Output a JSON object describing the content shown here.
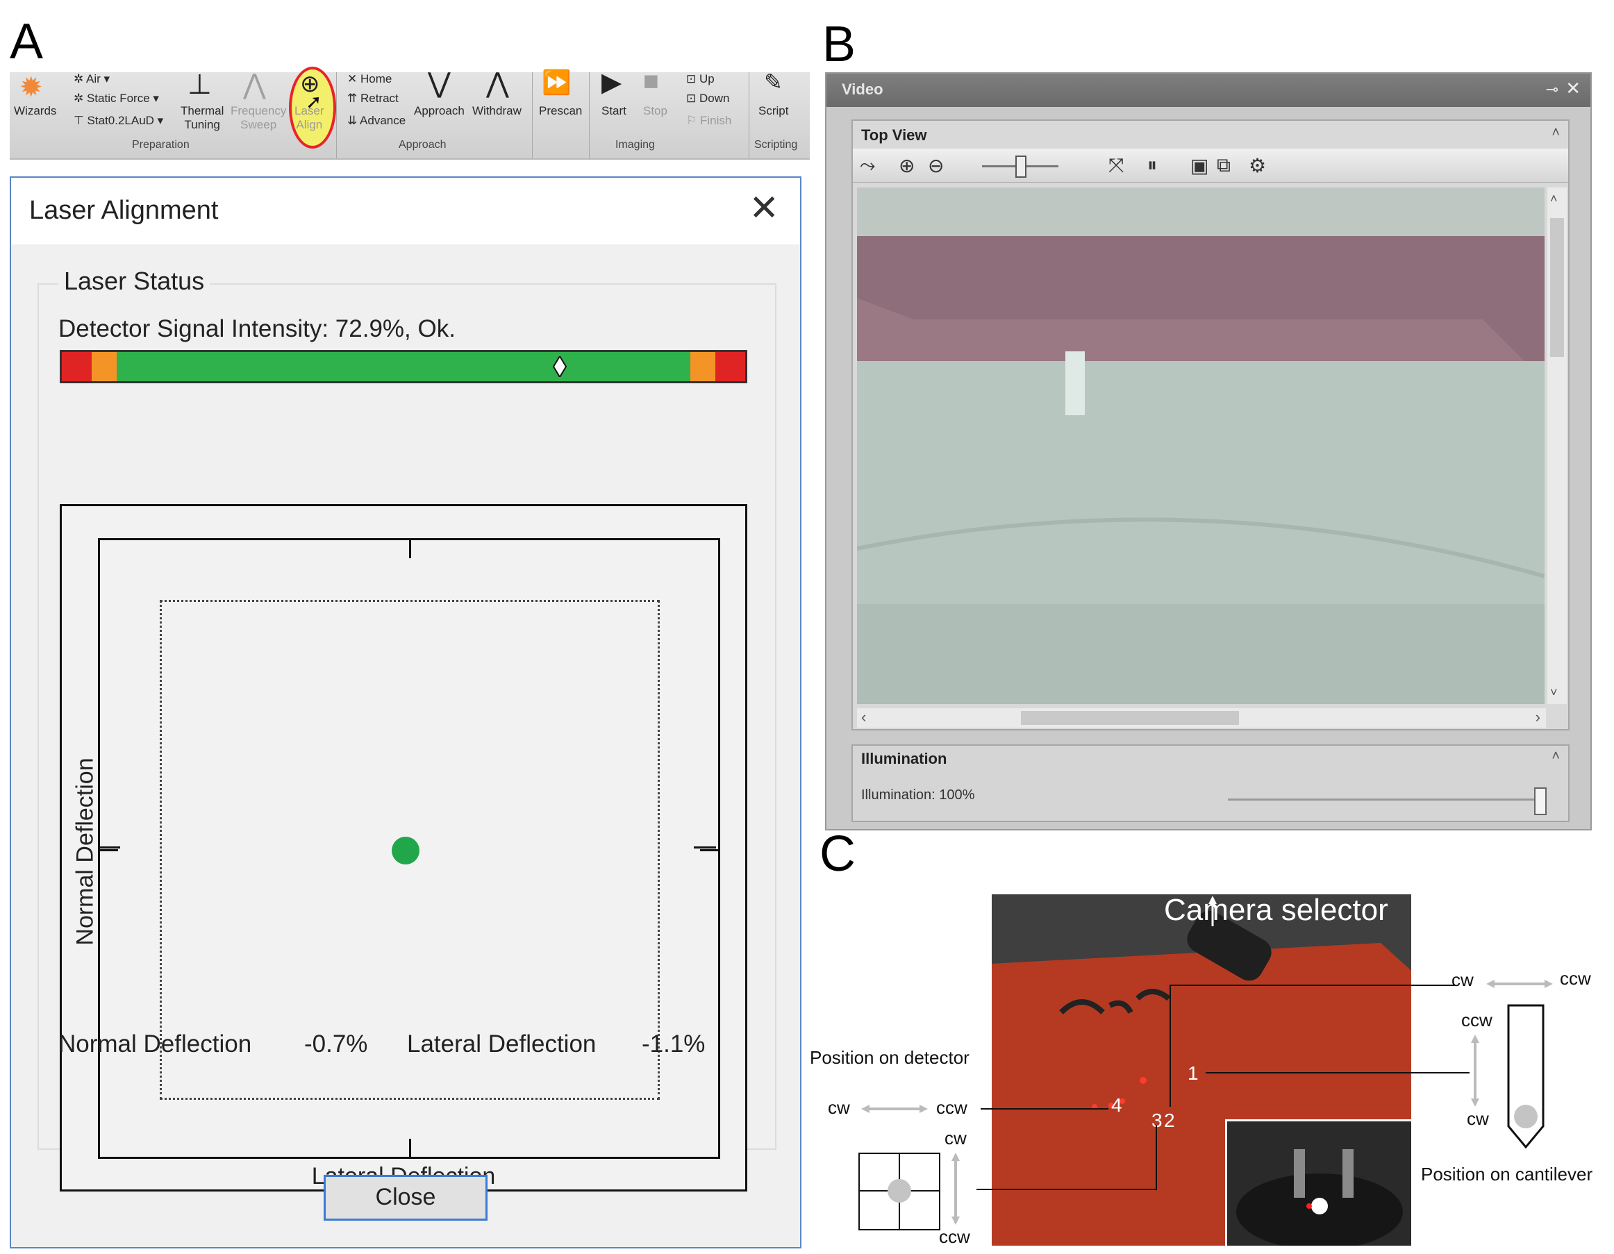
{
  "panels": {
    "a": "A",
    "b": "B",
    "c": "C"
  },
  "ribbon": {
    "mode_air": "Air",
    "mode_static_force": "Static Force",
    "probe": "Stat0.2LAuD",
    "wizards": "Wizards",
    "thermal_tuning": [
      "Thermal",
      "Tuning"
    ],
    "frequency_sweep": [
      "Frequency",
      "Sweep"
    ],
    "laser_align": [
      "Laser",
      "Align"
    ],
    "home": "Home",
    "retract": "Retract",
    "advance": "Advance",
    "approach": "Approach",
    "withdraw": "Withdraw",
    "prescan": "Prescan",
    "start": "Start",
    "stop": "Stop",
    "up": "Up",
    "down": "Down",
    "finish": "Finish",
    "script": "Script",
    "groups": {
      "preparation": "Preparation",
      "approach": "Approach",
      "imaging": "Imaging",
      "scripting": "Scripting"
    },
    "highlight_color": "#e8232a"
  },
  "dialog": {
    "title": "Laser Alignment",
    "group_label": "Laser Status",
    "signal_label": "Detector Signal Intensity: 72.9%, Ok.",
    "signal_intensity_percent": 72.9,
    "bar_colors": {
      "red": "#e02424",
      "orange": "#f59426",
      "green": "#2fb24c"
    },
    "plot": {
      "x_label": "Lateral Deflection",
      "y_label": "Normal Deflection",
      "spot_color": "#22a64b"
    },
    "normal_deflection_label": "Normal Deflection",
    "normal_deflection_value": "-0.7%",
    "lateral_deflection_label": "Lateral Deflection",
    "lateral_deflection_value": "-1.1%",
    "close_label": "Close"
  },
  "video": {
    "title": "Video",
    "top_view_label": "Top View",
    "illumination_label": "Illumination",
    "illumination_value": "Illumination: 100%",
    "illumination_level": 1.0
  },
  "panel_c": {
    "camera_selector": "Camera selector",
    "position_on_detector": "Position on detector",
    "position_on_cantilever": "Position on cantilever",
    "cw": "cw",
    "ccw": "ccw",
    "screw_labels": [
      "1",
      "4",
      "3",
      "2"
    ],
    "housing_color": "#b3361f"
  }
}
